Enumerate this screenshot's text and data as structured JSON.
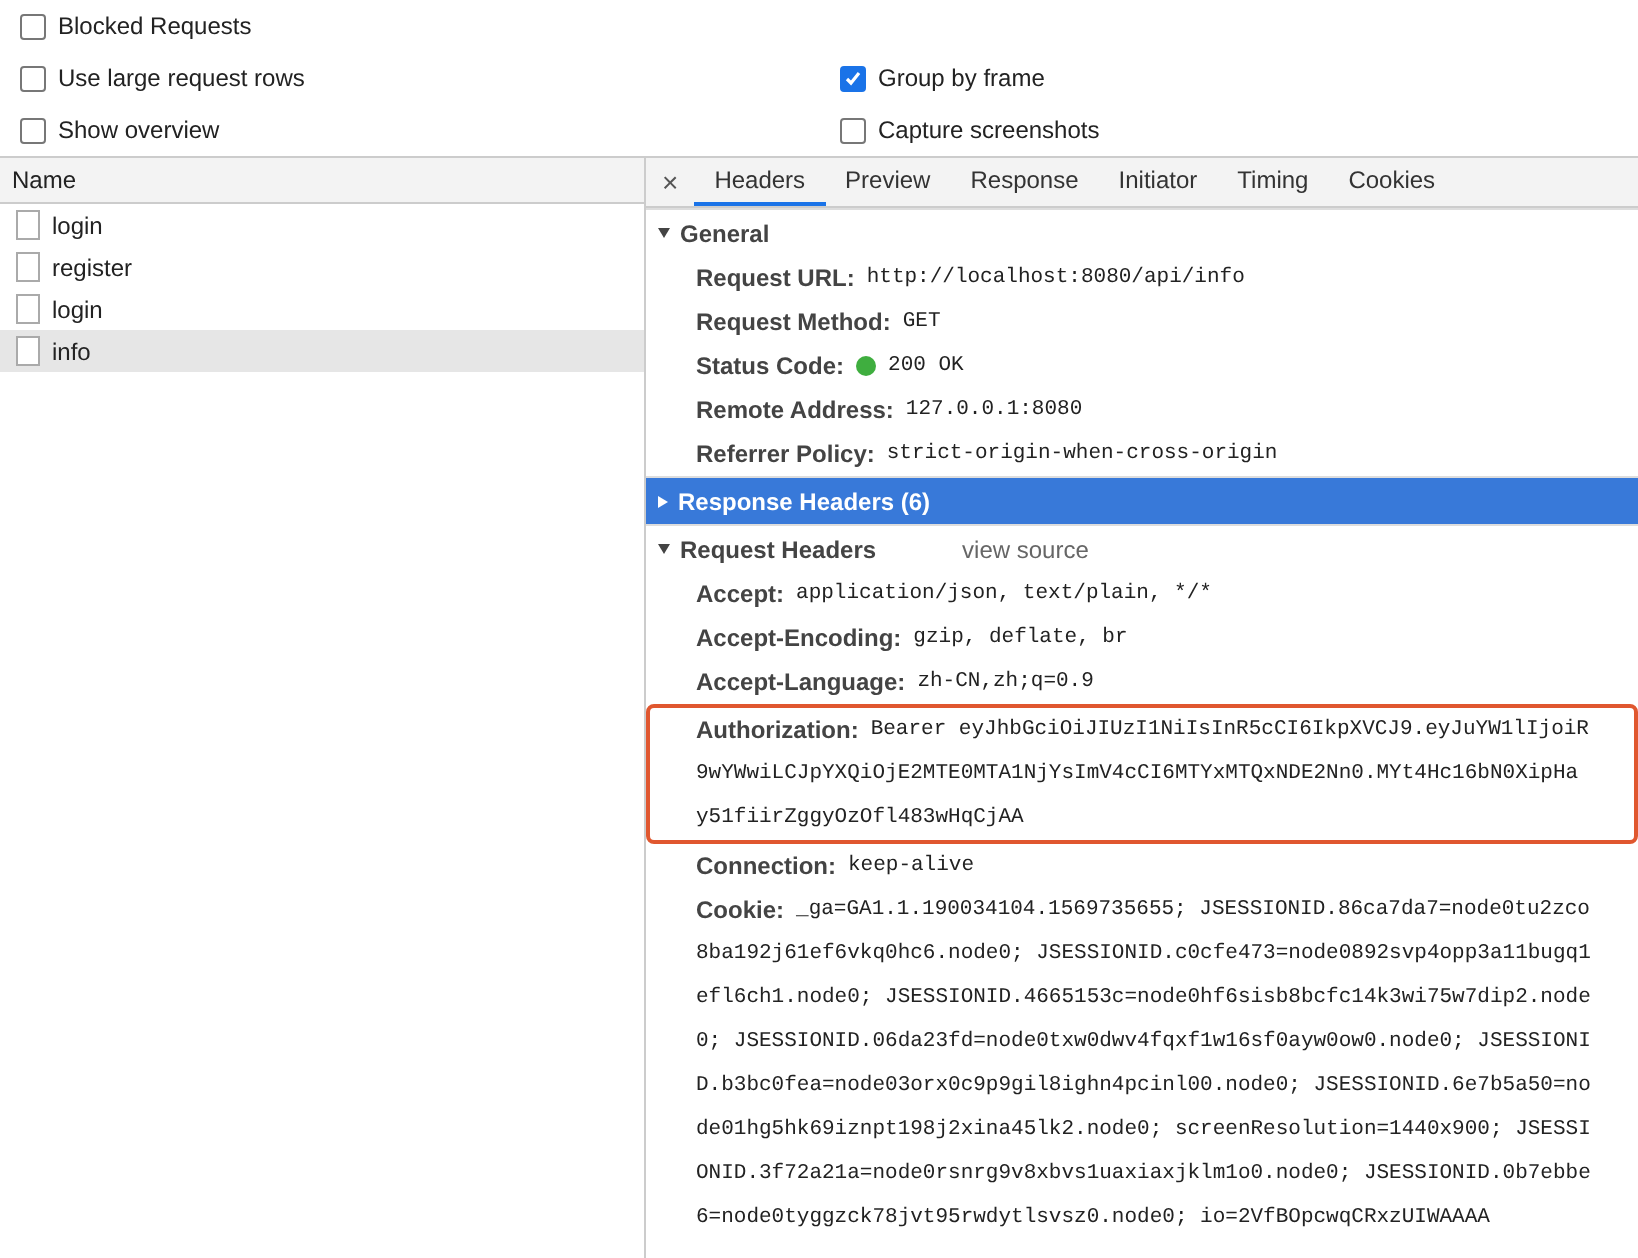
{
  "options": [
    {
      "label": "Blocked Requests",
      "checked": false
    },
    {
      "label": "Use large request rows",
      "checked": false
    },
    {
      "label": "Group by frame",
      "checked": true
    },
    {
      "label": "Show overview",
      "checked": false
    },
    {
      "label": "Capture screenshots",
      "checked": false
    }
  ],
  "requests": {
    "column": "Name",
    "rows": [
      {
        "name": "login",
        "selected": false
      },
      {
        "name": "register",
        "selected": false
      },
      {
        "name": "login",
        "selected": false
      },
      {
        "name": "info",
        "selected": true
      }
    ]
  },
  "close": "×",
  "tabs": [
    {
      "label": "Headers",
      "selected": true
    },
    {
      "label": "Preview",
      "selected": false
    },
    {
      "label": "Response",
      "selected": false
    },
    {
      "label": "Initiator",
      "selected": false
    },
    {
      "label": "Timing",
      "selected": false
    },
    {
      "label": "Cookies",
      "selected": false
    }
  ],
  "sections": [
    {
      "title": "General",
      "expanded": true,
      "selected": false,
      "rows": [
        {
          "name": "Request URL:",
          "lines": [
            "http://localhost:8080/api/info"
          ]
        },
        {
          "name": "Request Method:",
          "lines": [
            "GET"
          ]
        },
        {
          "name": "Status Code:",
          "success": true,
          "lines": [
            "200 OK"
          ]
        },
        {
          "name": "Remote Address:",
          "lines": [
            "127.0.0.1:8080"
          ]
        },
        {
          "name": "Referrer Policy:",
          "lines": [
            "strict-origin-when-cross-origin"
          ]
        }
      ]
    },
    {
      "title": "Response Headers (6)",
      "expanded": false,
      "selected": true
    },
    {
      "title": "Request Headers",
      "link": "view source",
      "expanded": true,
      "selected": false,
      "rows": [
        {
          "name": "Accept:",
          "lines": [
            "application/json, text/plain, */*"
          ]
        },
        {
          "name": "Accept-Encoding:",
          "lines": [
            "gzip, deflate, br"
          ]
        },
        {
          "name": "Accept-Language:",
          "lines": [
            "zh-CN,zh;q=0.9"
          ]
        },
        {
          "name": "Authorization:",
          "highlighted": true,
          "lines": [
            "Bearer eyJhbGciOiJIUzI1NiIsInR5cCI6IkpXVCJ9.eyJuYW1lIjoiR",
            "9wYWwiLCJpYXQiOjE2MTE0MTA1NjYsImV4cCI6MTYxMTQxNDE2Nn0.MYt4Hc16bN0XipHa",
            "y51fiirZggyOzOfl483wHqCjAA"
          ]
        },
        {
          "name": "Connection:",
          "lines": [
            "keep-alive"
          ]
        },
        {
          "name": "Cookie:",
          "lines": [
            "_ga=GA1.1.190034104.1569735655; JSESSIONID.86ca7da7=node0tu2zco",
            "8ba192j61ef6vkq0hc6.node0; JSESSIONID.c0cfe473=node0892svp4opp3a11bugq1",
            "efl6ch1.node0; JSESSIONID.4665153c=node0hf6sisb8bcfc14k3wi75w7dip2.node",
            "0; JSESSIONID.06da23fd=node0txw0dwv4fqxf1w16sf0ayw0ow0.node0; JSESSIONI",
            "D.b3bc0fea=node03orx0c9p9gil8ighn4pcinl00.node0; JSESSIONID.6e7b5a50=no",
            "de01hg5hk69iznpt198j2xina45lk2.node0; screenResolution=1440x900; JSESSI",
            "ONID.3f72a21a=node0rsnrg9v8xbvs1uaxiaxjklm1o0.node0; JSESSIONID.0b7ebbe",
            "6=node0tyggzck78jvt95rwdytlsvsz0.node0; io=2VfBOpcwqCRxzUIWAAAA"
          ]
        }
      ]
    }
  ]
}
